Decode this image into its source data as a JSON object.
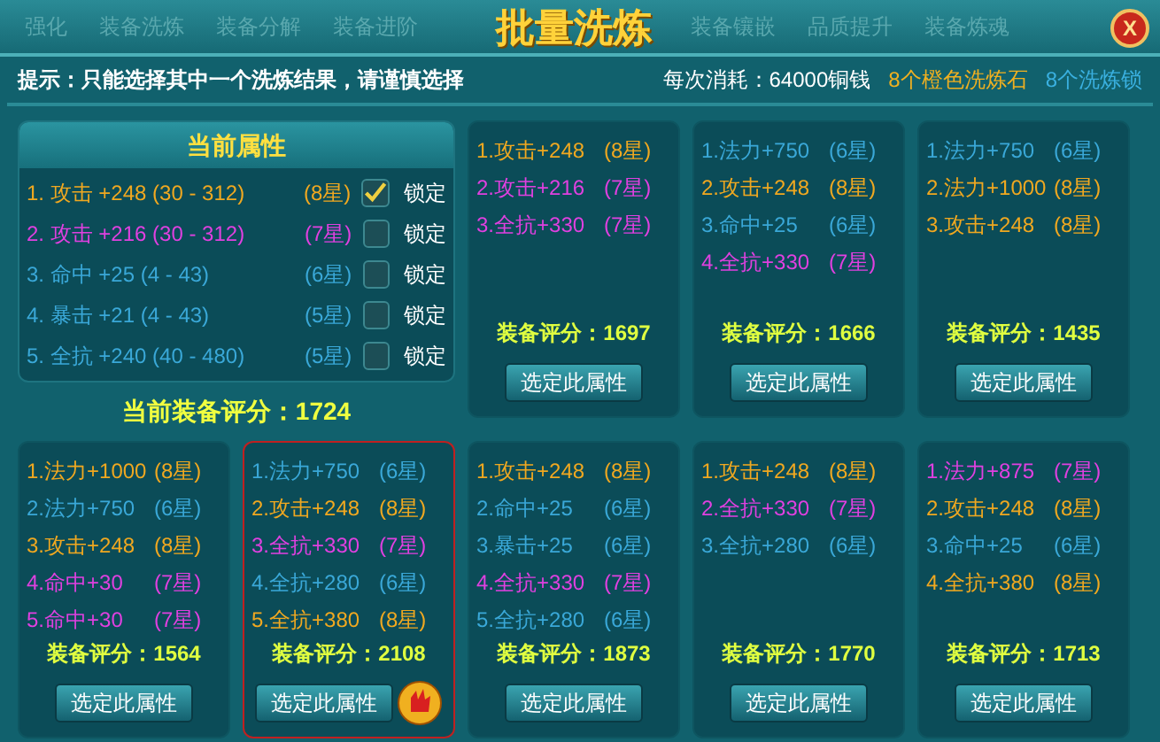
{
  "window": {
    "title": "批量洗炼",
    "close": "X"
  },
  "tabs_left": [
    "强化",
    "装备洗炼",
    "装备分解",
    "装备进阶"
  ],
  "tabs_right": [
    "装备镶嵌",
    "品质提升",
    "装备炼魂"
  ],
  "tip": "提示：只能选择其中一个洗炼结果，请谨慎选择",
  "cost": {
    "label": "每次消耗：64000铜钱",
    "stones": "8个橙色洗炼石",
    "locks": "8个洗炼锁"
  },
  "current": {
    "title": "当前属性",
    "rows": [
      {
        "text": "1. 攻击 +248 (30 - 312)",
        "grade": "(8星)",
        "color": "#f0a820",
        "locked": true,
        "lock_label": "锁定"
      },
      {
        "text": "2. 攻击 +216 (30 - 312)",
        "grade": "(7星)",
        "color": "#e040e0",
        "locked": false,
        "lock_label": "锁定"
      },
      {
        "text": "3. 命中 +25 (4 - 43)",
        "grade": "(6星)",
        "color": "#3aa8d8",
        "locked": false,
        "lock_label": "锁定"
      },
      {
        "text": "4. 暴击 +21 (4 - 43)",
        "grade": "(5星)",
        "color": "#3aa8d8",
        "locked": false,
        "lock_label": "锁定"
      },
      {
        "text": "5. 全抗 +240 (40 - 480)",
        "grade": "(5星)",
        "color": "#3aa8d8",
        "locked": false,
        "lock_label": "锁定"
      }
    ],
    "score": "当前装备评分：1724"
  },
  "results": [
    {
      "selected": false,
      "score": "装备评分：1697",
      "button": "选定此属性",
      "lines": [
        {
          "stat": "1.攻击+248",
          "grade": "(8星)",
          "color": "#f0a820"
        },
        {
          "stat": "2.攻击+216",
          "grade": "(7星)",
          "color": "#e040e0"
        },
        {
          "stat": "3.全抗+330",
          "grade": "(7星)",
          "color": "#e040e0"
        }
      ]
    },
    {
      "selected": false,
      "score": "装备评分：1666",
      "button": "选定此属性",
      "lines": [
        {
          "stat": "1.法力+750",
          "grade": "(6星)",
          "color": "#3aa8d8"
        },
        {
          "stat": "2.攻击+248",
          "grade": "(8星)",
          "color": "#f0a820"
        },
        {
          "stat": "3.命中+25",
          "grade": "(6星)",
          "color": "#3aa8d8"
        },
        {
          "stat": "4.全抗+330",
          "grade": "(7星)",
          "color": "#e040e0"
        }
      ]
    },
    {
      "selected": false,
      "score": "装备评分：1435",
      "button": "选定此属性",
      "lines": [
        {
          "stat": "1.法力+750",
          "grade": "(6星)",
          "color": "#3aa8d8"
        },
        {
          "stat": "2.法力+1000",
          "grade": "(8星)",
          "color": "#f0a820"
        },
        {
          "stat": "3.攻击+248",
          "grade": "(8星)",
          "color": "#f0a820"
        }
      ]
    },
    {
      "selected": false,
      "score": "装备评分：1564",
      "button": "选定此属性",
      "lines": [
        {
          "stat": "1.法力+1000",
          "grade": "(8星)",
          "color": "#f0a820"
        },
        {
          "stat": "2.法力+750",
          "grade": "(6星)",
          "color": "#3aa8d8"
        },
        {
          "stat": "3.攻击+248",
          "grade": "(8星)",
          "color": "#f0a820"
        },
        {
          "stat": "4.命中+30",
          "grade": "(7星)",
          "color": "#e040e0"
        },
        {
          "stat": "5.命中+30",
          "grade": "(7星)",
          "color": "#e040e0"
        }
      ]
    },
    {
      "selected": true,
      "score": "装备评分：2108",
      "button": "选定此属性",
      "lines": [
        {
          "stat": "1.法力+750",
          "grade": "(6星)",
          "color": "#3aa8d8"
        },
        {
          "stat": "2.攻击+248",
          "grade": "(8星)",
          "color": "#f0a820"
        },
        {
          "stat": "3.全抗+330",
          "grade": "(7星)",
          "color": "#e040e0"
        },
        {
          "stat": "4.全抗+280",
          "grade": "(6星)",
          "color": "#3aa8d8"
        },
        {
          "stat": "5.全抗+380",
          "grade": "(8星)",
          "color": "#f0a820"
        }
      ]
    },
    {
      "selected": false,
      "score": "装备评分：1873",
      "button": "选定此属性",
      "lines": [
        {
          "stat": "1.攻击+248",
          "grade": "(8星)",
          "color": "#f0a820"
        },
        {
          "stat": "2.命中+25",
          "grade": "(6星)",
          "color": "#3aa8d8"
        },
        {
          "stat": "3.暴击+25",
          "grade": "(6星)",
          "color": "#3aa8d8"
        },
        {
          "stat": "4.全抗+330",
          "grade": "(7星)",
          "color": "#e040e0"
        },
        {
          "stat": "5.全抗+280",
          "grade": "(6星)",
          "color": "#3aa8d8"
        }
      ]
    },
    {
      "selected": false,
      "score": "装备评分：1770",
      "button": "选定此属性",
      "lines": [
        {
          "stat": "1.攻击+248",
          "grade": "(8星)",
          "color": "#f0a820"
        },
        {
          "stat": "2.全抗+330",
          "grade": "(7星)",
          "color": "#e040e0"
        },
        {
          "stat": "3.全抗+280",
          "grade": "(6星)",
          "color": "#3aa8d8"
        }
      ]
    },
    {
      "selected": false,
      "score": "装备评分：1713",
      "button": "选定此属性",
      "lines": [
        {
          "stat": "1.法力+875",
          "grade": "(7星)",
          "color": "#e040e0"
        },
        {
          "stat": "2.攻击+248",
          "grade": "(8星)",
          "color": "#f0a820"
        },
        {
          "stat": "3.命中+25",
          "grade": "(6星)",
          "color": "#3aa8d8"
        },
        {
          "stat": "4.全抗+380",
          "grade": "(8星)",
          "color": "#f0a820"
        }
      ]
    }
  ]
}
